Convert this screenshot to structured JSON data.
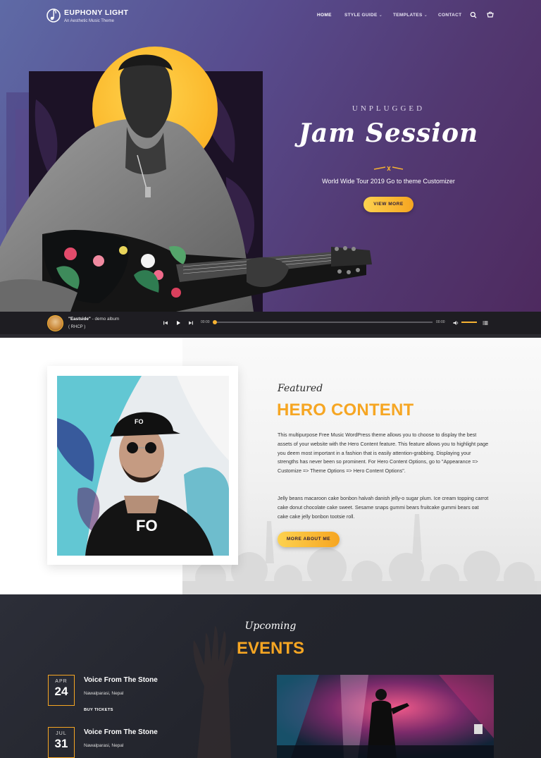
{
  "site": {
    "title": "EUPHONY LIGHT",
    "tagline": "An Aesthetic Music Theme"
  },
  "nav": {
    "items": [
      {
        "label": "HOME"
      },
      {
        "label": "STYLE GUIDE"
      },
      {
        "label": "TEMPLATES"
      },
      {
        "label": "CONTACT"
      }
    ],
    "icons": [
      "search-icon",
      "cart-icon"
    ]
  },
  "hero": {
    "kicker": "UNPLUGGED",
    "title": "Jam Session",
    "subtitle": "World Wide Tour 2019 Go to theme Customizer",
    "button": "VIEW MORE"
  },
  "player": {
    "track_title": "\"Eastside\"",
    "track_album": " - demo album",
    "artist": "( RHCP )",
    "current_time": "00:00",
    "duration": "00:00",
    "progress": 0,
    "volume": 1.0
  },
  "feature": {
    "script": "Featured",
    "title": "HERO CONTENT",
    "paragraph1": "This multipurpose Free Music WordPress theme allows you to choose to display the best assets of your website with the Hero Content feature. This feature allows you to highlight page you deem most important in a fashion that is easily attention-grabbing. Displaying your strengths has never been so prominent. For Hero Content Options, go to \"Appearance => Customize => Theme Options => Hero Content Options\".",
    "paragraph2": "Jelly beans macaroon cake bonbon halvah danish jelly-o sugar plum. Ice cream topping carrot cake donut chocolate cake sweet. Sesame snaps gummi bears fruitcake gummi bears oat cake cake jelly bonbon tootsie roll.",
    "button": "MORE ABOUT ME"
  },
  "events": {
    "script": "Upcoming",
    "title": "EVENTS",
    "items": [
      {
        "month": "APR",
        "day": "24",
        "name": "Voice From The Stone",
        "location": "Nawalparasi, Nepal",
        "link": "BUY TICKETS"
      },
      {
        "month": "JUL",
        "day": "31",
        "name": "Voice From The Stone",
        "location": "Nawalparasi, Nepal"
      }
    ]
  },
  "colors": {
    "accent": "#f6a623",
    "hero_gradient_start": "#5e6aa6",
    "hero_gradient_end": "#4e2a5f",
    "player_bg": "#1e1d22",
    "events_bg": "#23252d"
  }
}
